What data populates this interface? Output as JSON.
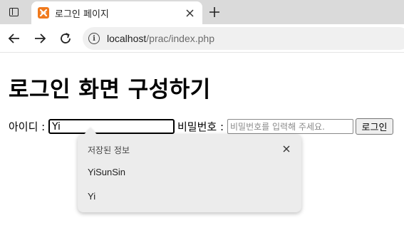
{
  "browser": {
    "tab": {
      "title": "로그인 페이지",
      "favicon": "xampp-icon"
    },
    "url": {
      "host": "localhost",
      "path": "/prac/index.php"
    },
    "icons": {
      "window": "window-icon",
      "close": "close-icon",
      "new_tab": "plus-icon",
      "back": "back-arrow-icon",
      "forward": "forward-arrow-icon",
      "reload": "reload-icon",
      "site_info": "info-icon"
    }
  },
  "page": {
    "title": "로그인 화면 구성하기",
    "id_label": "아이디 :",
    "id_value": "Yi",
    "pw_label": "비밀번호 :",
    "pw_placeholder": "비밀번호를 입력해 주세요.",
    "login_button": "로그인"
  },
  "autofill": {
    "header": "저장된 정보",
    "items": [
      "YiSunSin",
      "Yi"
    ]
  },
  "colors": {
    "tabstrip": "#dadada",
    "favicon": "#f07a1d",
    "popup": "#ececec"
  }
}
